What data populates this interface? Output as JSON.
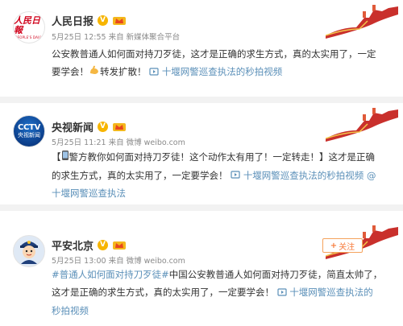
{
  "posts": [
    {
      "account": "人民日报",
      "avatar_text": "人民日報",
      "avatar_sub": "PEOPLE'S DAILY",
      "verified": "V",
      "time": "5月25日 12:55",
      "source_prefix": "来自",
      "source": "新媒体聚合平台",
      "text_1": "公安教普通人如何面对持刀歹徒，这才是正确的求生方式，真的太实用了，一定",
      "text_2": "要学会！",
      "text_3": "转发扩散！",
      "video_link": "十堰网警巡查执法的秒拍视频"
    },
    {
      "account": "央视新闻",
      "avatar_mark": "CCTV",
      "avatar_sub": "央视新闻",
      "verified": "V",
      "time": "5月25日 11:21",
      "source_prefix": "来自",
      "source": "微博 weibo.com",
      "text_1a": "【",
      "text_1b": "警方教你如何面对持刀歹徒！这个动作太有用了！一定转走！】这才是正确",
      "text_2a": "的求生方式，真的太实用了，一定要学会！",
      "video_link_a": "十堰网警巡查执法的秒拍视频",
      "mention_1": "@",
      "mention_2": "十堰网警巡查执法"
    },
    {
      "account": "平安北京",
      "verified": "V",
      "time": "5月25日 13:00",
      "source_prefix": "来自",
      "source": "微博 weibo.com",
      "topic": "#普通人如何面对持刀歹徒#",
      "text_1": "中国公安教普通人如何面对持刀歹徒，简直太帅了，",
      "text_2": "这才是正确的求生方式，真的太实用了，一定要学会！",
      "video_link_1": "十堰网警巡查执法的",
      "video_link_2": "秒拍视频",
      "follow_label": "关注",
      "follow_plus": "+"
    }
  ],
  "colors": {
    "link": "#5a8fb8",
    "verified_badge": "#f7b500",
    "follow_border": "#f5a35c",
    "meta_text": "#8a8a8a"
  },
  "icons": [
    "verified-badge-icon",
    "level-crown-icon",
    "video-link-icon",
    "muscle-emoji-icon",
    "phone-emoji-icon",
    "great-wall-decoration-icon",
    "police-mascot-icon"
  ]
}
